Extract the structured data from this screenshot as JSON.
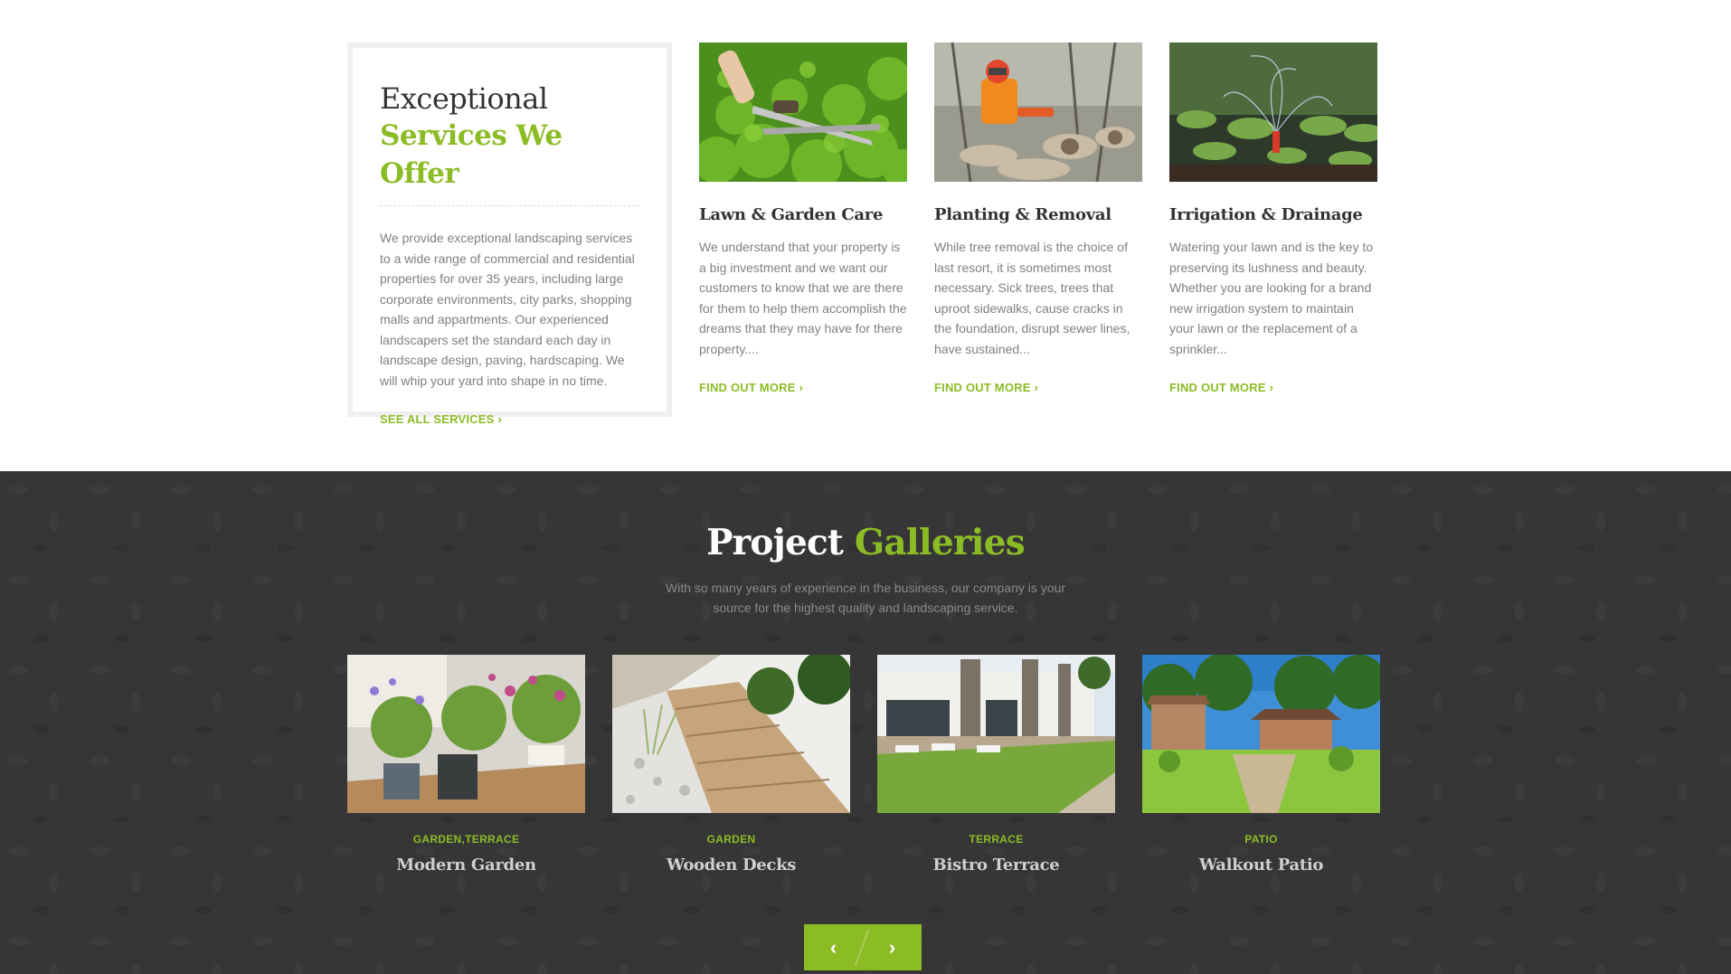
{
  "services": {
    "intro": {
      "title_line1": "Exceptional",
      "title_line2": "Services We Offer",
      "text": "We provide exceptional landscaping services to a wide range of commercial and residential properties for over 35 years, including large corporate environments, city parks, shopping malls and appartments. Our experienced landscapers set the standard each day in landscape design, paving, hardscaping. We will whip your yard into shape in no time.",
      "link_label": "SEE ALL SERVICES"
    },
    "items": [
      {
        "title": "Lawn & Garden Care",
        "text": "We understand that your property is a big investment and we want our customers to know that we are there for them to help them accomplish the dreams that they may have for there property....",
        "link_label": "FIND OUT MORE"
      },
      {
        "title": "Planting & Removal",
        "text": "While tree removal is the choice of last resort, it is sometimes most necessary. Sick trees, trees that uproot sidewalks, cause cracks in the foundation, disrupt sewer lines, have sustained...",
        "link_label": "FIND OUT MORE"
      },
      {
        "title": "Irrigation & Drainage",
        "text": "Watering your lawn and is the key to preserving its lushness and beauty. Whether you are looking for a brand new irrigation system to maintain your lawn or the replacement of a sprinkler...",
        "link_label": "FIND OUT MORE"
      }
    ]
  },
  "galleries": {
    "title_plain": "Project",
    "title_accent": "Galleries",
    "subtitle_line1": "With so many years of experience in the business, our company is your",
    "subtitle_line2": "source for the highest quality and landscaping service.",
    "projects": [
      {
        "category": "GARDEN,TERRACE",
        "name": "Modern Garden"
      },
      {
        "category": "GARDEN",
        "name": "Wooden Decks"
      },
      {
        "category": "TERRACE",
        "name": "Bistro Terrace"
      },
      {
        "category": "PATIO",
        "name": "Walkout Patio"
      }
    ],
    "nav": {
      "prev_icon": "chevron-left-icon",
      "next_icon": "chevron-right-icon"
    }
  },
  "colors": {
    "accent": "#8cbc25",
    "dark_bg": "#363636"
  }
}
